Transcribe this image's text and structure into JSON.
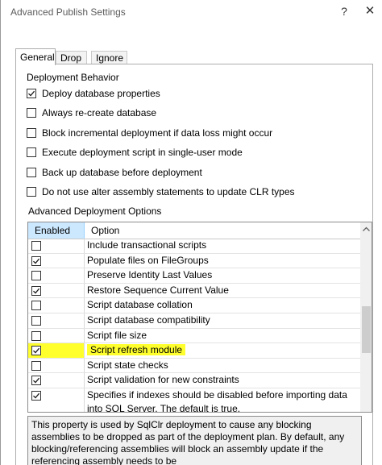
{
  "window": {
    "title": "Advanced Publish Settings",
    "help": "?",
    "close": "✕"
  },
  "tabs": [
    {
      "label": "General",
      "active": true
    },
    {
      "label": "Drop",
      "active": false
    },
    {
      "label": "Ignore",
      "active": false
    }
  ],
  "deployment_behavior": {
    "label": "Deployment Behavior",
    "options": [
      {
        "label": "Deploy database properties",
        "checked": true
      },
      {
        "label": "Always re-create database",
        "checked": false
      },
      {
        "label": "Block incremental deployment if data loss might occur",
        "checked": false
      },
      {
        "label": "Execute deployment script in single-user mode",
        "checked": false
      },
      {
        "label": "Back up database before deployment",
        "checked": false
      },
      {
        "label": "Do not use alter assembly statements to update CLR types",
        "checked": false
      }
    ]
  },
  "advanced_options": {
    "label": "Advanced Deployment Options",
    "col_enabled": "Enabled",
    "col_option": "Option",
    "rows": [
      {
        "label": "Include transactional scripts",
        "checked": false
      },
      {
        "label": "Populate files on FileGroups",
        "checked": true
      },
      {
        "label": "Preserve Identity Last Values",
        "checked": false
      },
      {
        "label": "Restore Sequence Current Value",
        "checked": true
      },
      {
        "label": "Script database collation",
        "checked": false
      },
      {
        "label": "Script database compatibility",
        "checked": false
      },
      {
        "label": "Script file size",
        "checked": false
      },
      {
        "label": "Script refresh module",
        "checked": true,
        "highlighted": true
      },
      {
        "label": "Script state checks",
        "checked": false
      },
      {
        "label": "Script validation for new constraints",
        "checked": true
      },
      {
        "label": "Specifies if indexes should be disabled before importing data into SQL Server. The default is true.",
        "checked": true
      }
    ]
  },
  "description": "This property is used by SqlClr deployment to cause any blocking assemblies to be dropped as part of the deployment plan. By default, any blocking/referencing assemblies will block an assembly update if the referencing assembly needs to be",
  "colors": {
    "highlight": "#ffff2e",
    "header_selected": "#cce8ff"
  }
}
